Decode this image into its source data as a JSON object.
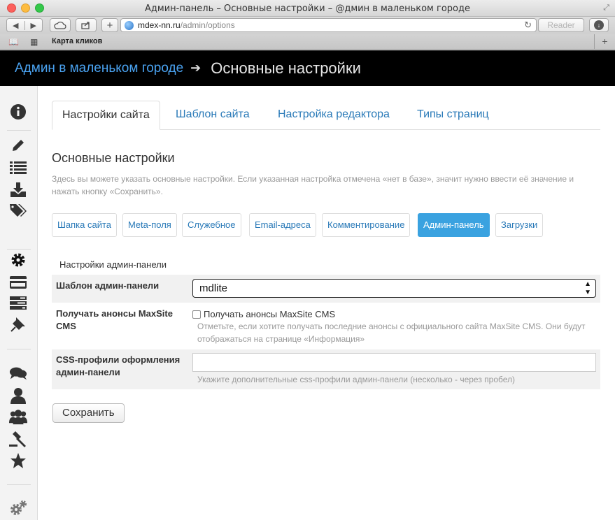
{
  "browser": {
    "window_title": "Админ-панель – Основные настройки – @дмин в маленьком городе",
    "address_domain": "mdex-nn.ru",
    "address_path": "/admin/options",
    "reader_label": "Reader",
    "bookmark_link": "Карта кликов"
  },
  "header": {
    "site_link": "Админ в маленьком городе",
    "arrow": "➔",
    "page_title": "Основные настройки"
  },
  "tabs": [
    {
      "label": "Настройки сайта",
      "active": true
    },
    {
      "label": "Шаблон сайта",
      "active": false
    },
    {
      "label": "Настройка редактора",
      "active": false
    },
    {
      "label": "Типы страниц",
      "active": false
    }
  ],
  "section": {
    "title": "Основные настройки",
    "description": "Здесь вы можете указать основные настройки. Если указанная настройка отмечена «нет в базе», значит нужно ввести её значение и нажать кнопку «Сохранить»."
  },
  "subtabs": [
    {
      "label": "Шапка сайта",
      "active": false
    },
    {
      "label": "Meta-поля",
      "active": false
    },
    {
      "label": "Служебное",
      "active": false
    },
    {
      "label": "Email-адреса",
      "active": false
    },
    {
      "label": "Комментирование",
      "active": false
    },
    {
      "label": "Админ-панель",
      "active": true
    },
    {
      "label": "Загрузки",
      "active": false
    }
  ],
  "form": {
    "group_title": "Настройки админ-панели",
    "template_label": "Шаблон админ-панели",
    "template_value": "mdlite",
    "announce_label": "Получать анонсы MaxSite CMS",
    "announce_checkbox_label": "Получать анонсы MaxSite CMS",
    "announce_checked": false,
    "announce_hint": "Отметьте, если хотите получать последние анонсы с официального сайта MaxSite CMS. Они будут отображаться на странице «Информация»",
    "css_label": "CSS-профили оформления админ-панели",
    "css_value": "",
    "css_hint": "Укажите дополнительные css-профили админ-панели (несколько - через пробел)",
    "save_label": "Сохранить"
  },
  "sidebar_icons": [
    "info-icon",
    "pencil-icon",
    "list-icon",
    "download-icon",
    "tags-icon",
    "gear-icon",
    "credit-card-icon",
    "tasks-icon",
    "pin-icon",
    "comments-icon",
    "user-icon",
    "users-icon",
    "gavel-icon",
    "star-icon",
    "cogs-icon"
  ],
  "colors": {
    "accent": "#3aa2e0",
    "link": "#2a7ab8",
    "header_bg": "#000000",
    "site_link": "#4aa2f0"
  }
}
